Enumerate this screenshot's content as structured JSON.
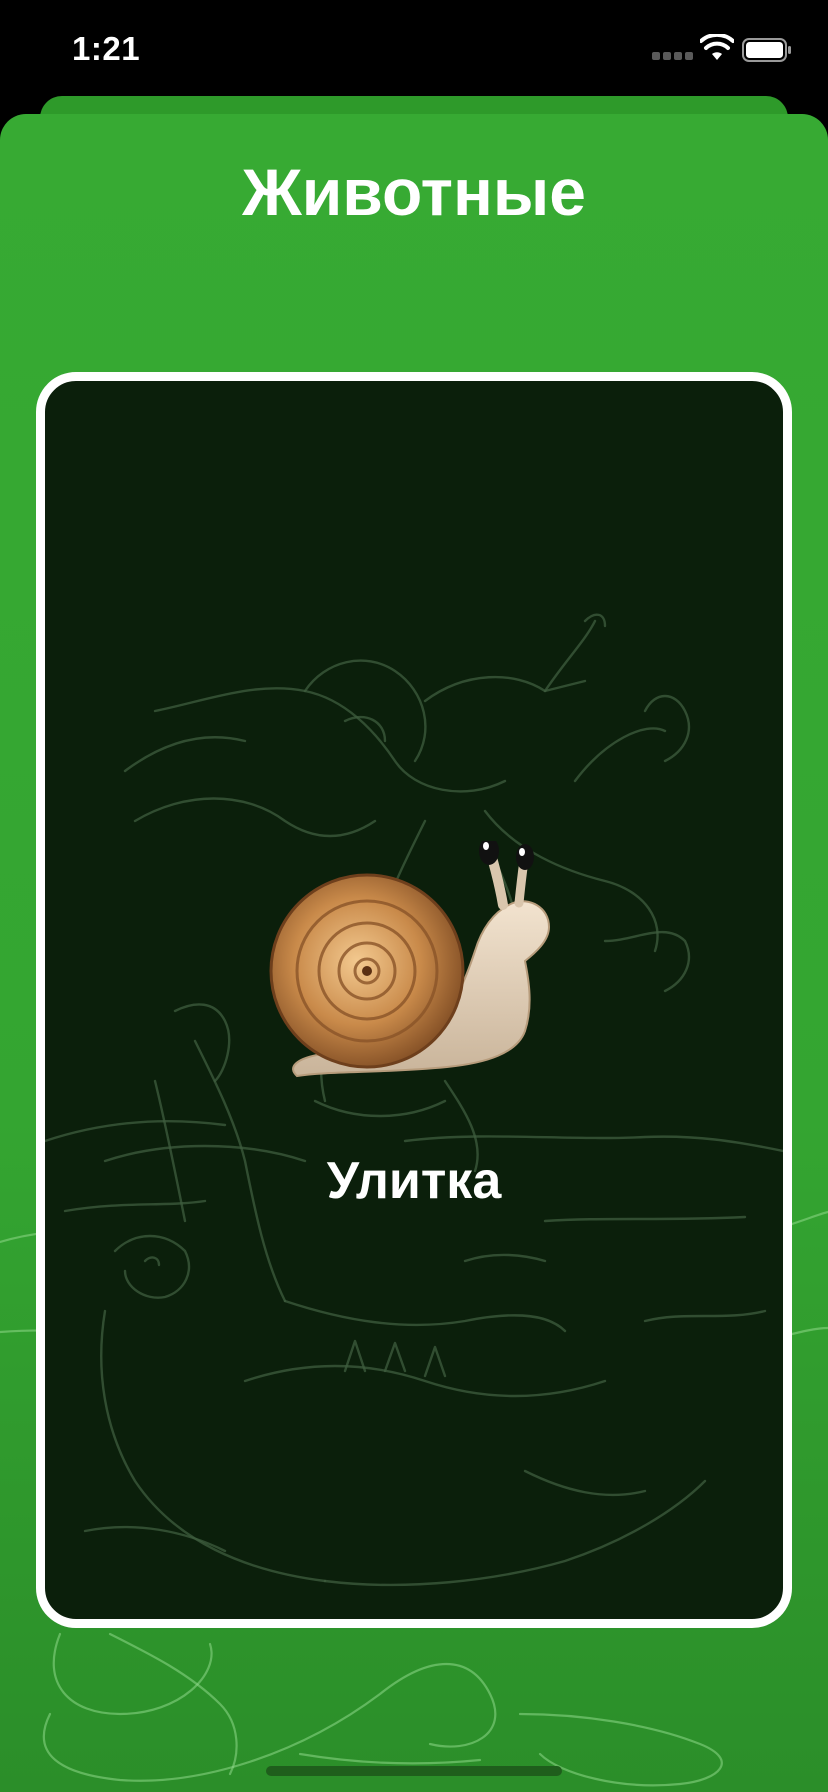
{
  "status_bar": {
    "time": "1:21",
    "signal_icon": "cellular-signal-icon",
    "wifi_icon": "wifi-icon",
    "battery_icon": "battery-icon"
  },
  "screen": {
    "title": "Животные"
  },
  "card": {
    "image_icon": "snail-icon",
    "word": "Улитка"
  },
  "colors": {
    "sheet_green": "#37aa33",
    "card_background": "#0b1f0b",
    "card_border": "#ffffff",
    "text": "#ffffff"
  }
}
